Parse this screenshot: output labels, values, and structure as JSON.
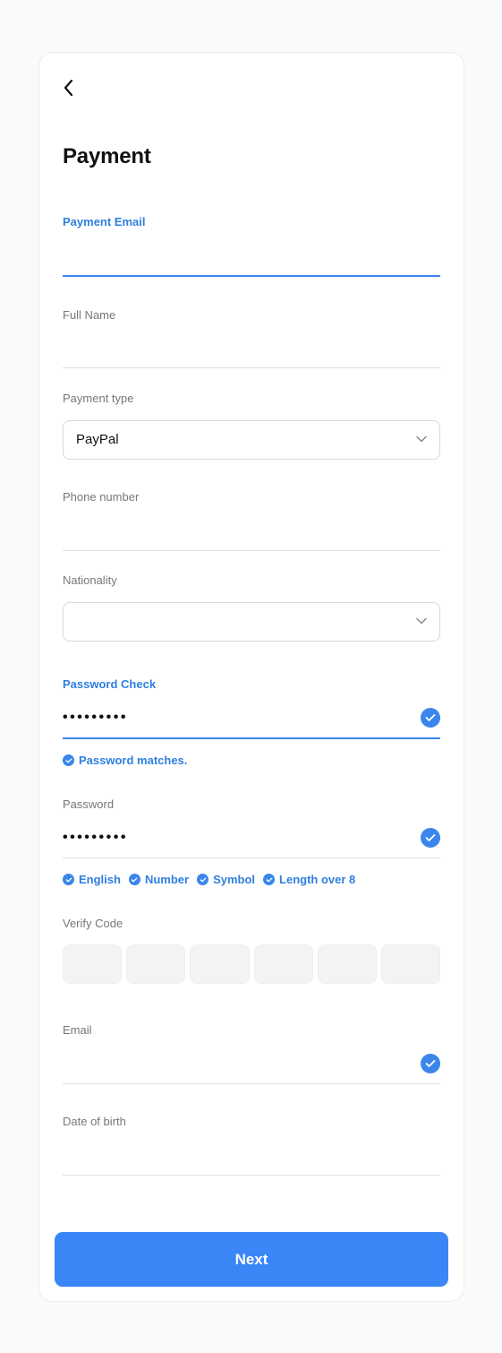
{
  "header": {
    "title": "Payment"
  },
  "fields": {
    "payment_email": {
      "label": "Payment Email",
      "value": ""
    },
    "full_name": {
      "label": "Full Name",
      "value": ""
    },
    "payment_type": {
      "label": "Payment type",
      "value": "PayPal"
    },
    "phone_number": {
      "label": "Phone number",
      "value": ""
    },
    "nationality": {
      "label": "Nationality",
      "value": ""
    },
    "password_check": {
      "label": "Password Check",
      "value": "•••••••••",
      "hint": "Password matches."
    },
    "password": {
      "label": "Password",
      "value": "•••••••••",
      "rules": [
        "English",
        "Number",
        "Symbol",
        "Length over 8"
      ]
    },
    "verify_code": {
      "label": "Verify Code",
      "digits": [
        "",
        "",
        "",
        "",
        "",
        ""
      ]
    },
    "email": {
      "label": "Email",
      "value": ""
    },
    "date_of_birth": {
      "label": "Date of birth",
      "value": ""
    }
  },
  "actions": {
    "next_label": "Next"
  },
  "colors": {
    "accent": "#3b86f7",
    "accent_text": "#2f7fe0",
    "line": "#e2e2e2",
    "code_box": "#f3f3f3"
  },
  "icons": {
    "back": "chevron-left-icon",
    "dropdown": "chevron-down-icon",
    "valid": "check-circle-icon"
  }
}
